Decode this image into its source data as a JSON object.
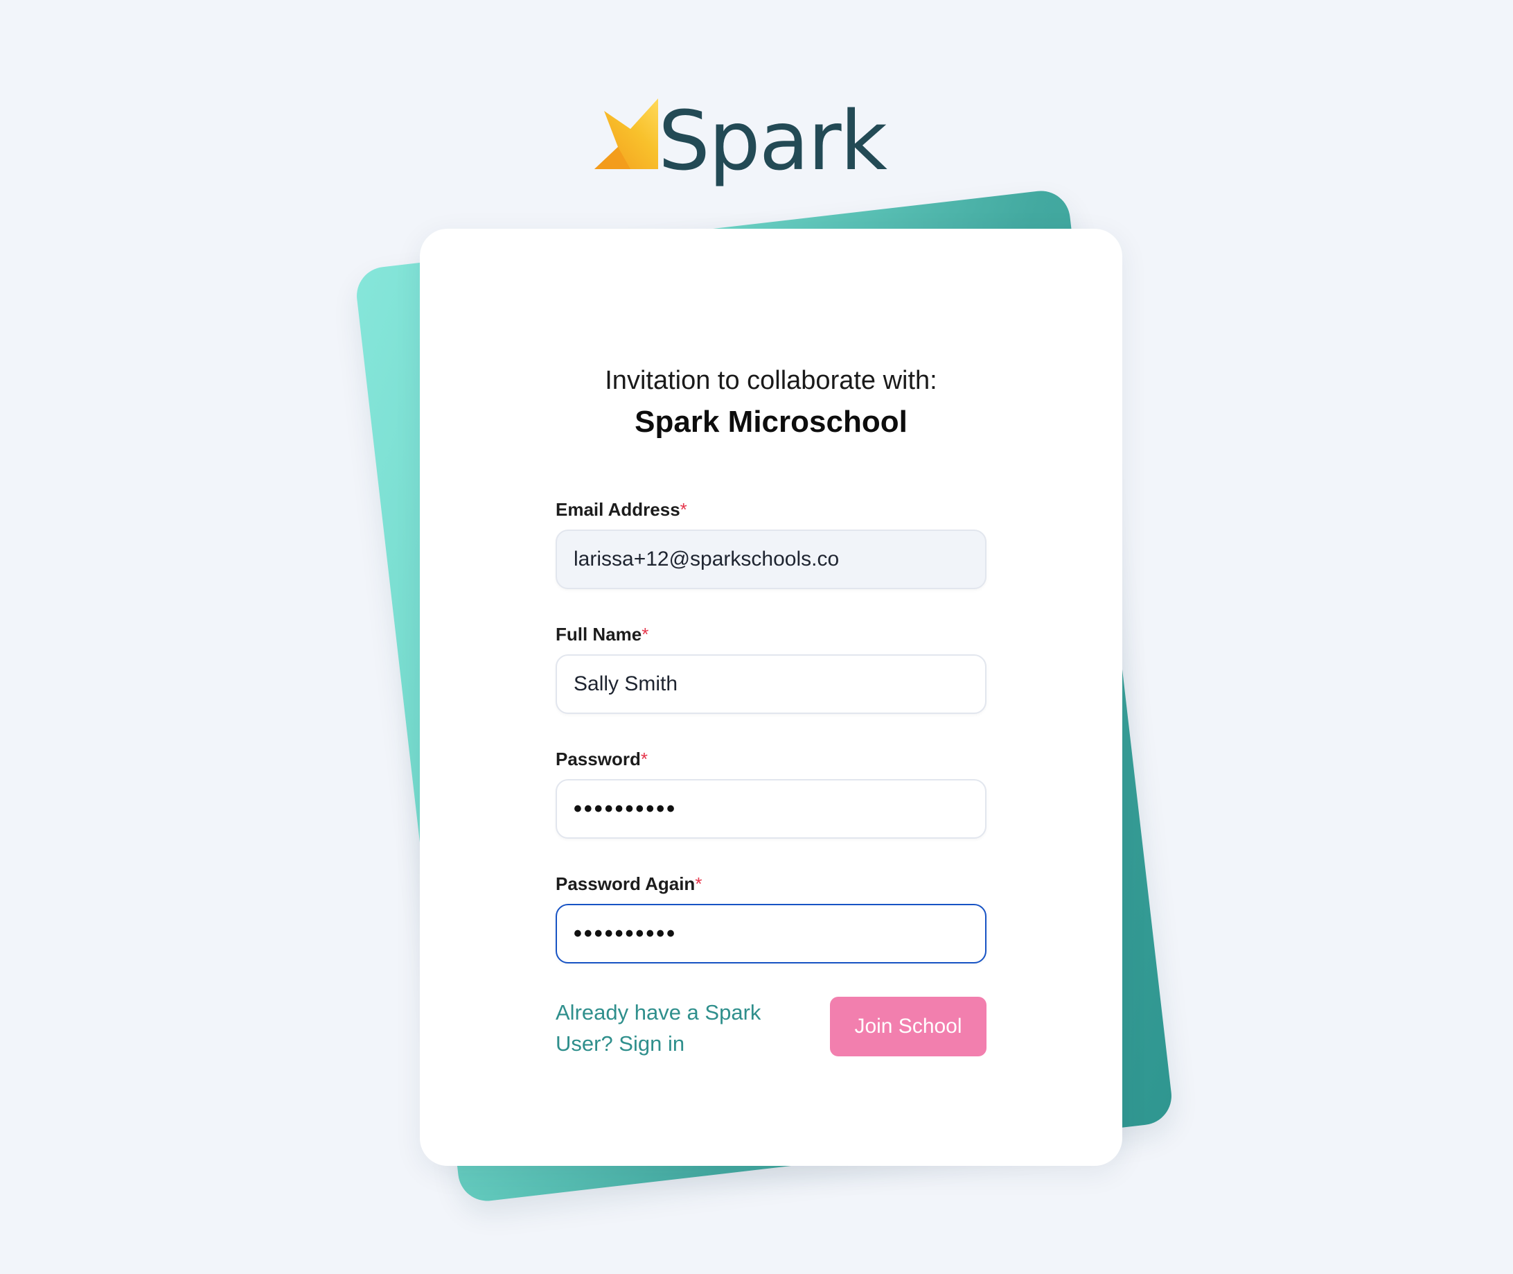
{
  "logo": {
    "text": "Spark",
    "icon": "spark-star-icon",
    "colors": {
      "text": "#234a55",
      "star": "#f7c02a"
    }
  },
  "invitation": {
    "intro": "Invitation to collaborate with:",
    "school_name": "Spark Microschool"
  },
  "form": {
    "email": {
      "label": "Email Address",
      "required_mark": "*",
      "value": "larissa+12@sparkschools.co"
    },
    "full_name": {
      "label": "Full Name",
      "required_mark": "*",
      "value": "Sally Smith"
    },
    "password": {
      "label": "Password",
      "required_mark": "*",
      "value": "••••••••••"
    },
    "password_again": {
      "label": "Password Again",
      "required_mark": "*",
      "value": "••••••••••"
    }
  },
  "actions": {
    "signin_link": "Already have a Spark User? Sign in",
    "join_button": "Join School"
  },
  "colors": {
    "accent_teal": "#2f8f8c",
    "button_pink": "#f27fae",
    "required_red": "#e5354b",
    "focus_blue": "#1753c4",
    "page_bg": "#f2f5fa"
  }
}
